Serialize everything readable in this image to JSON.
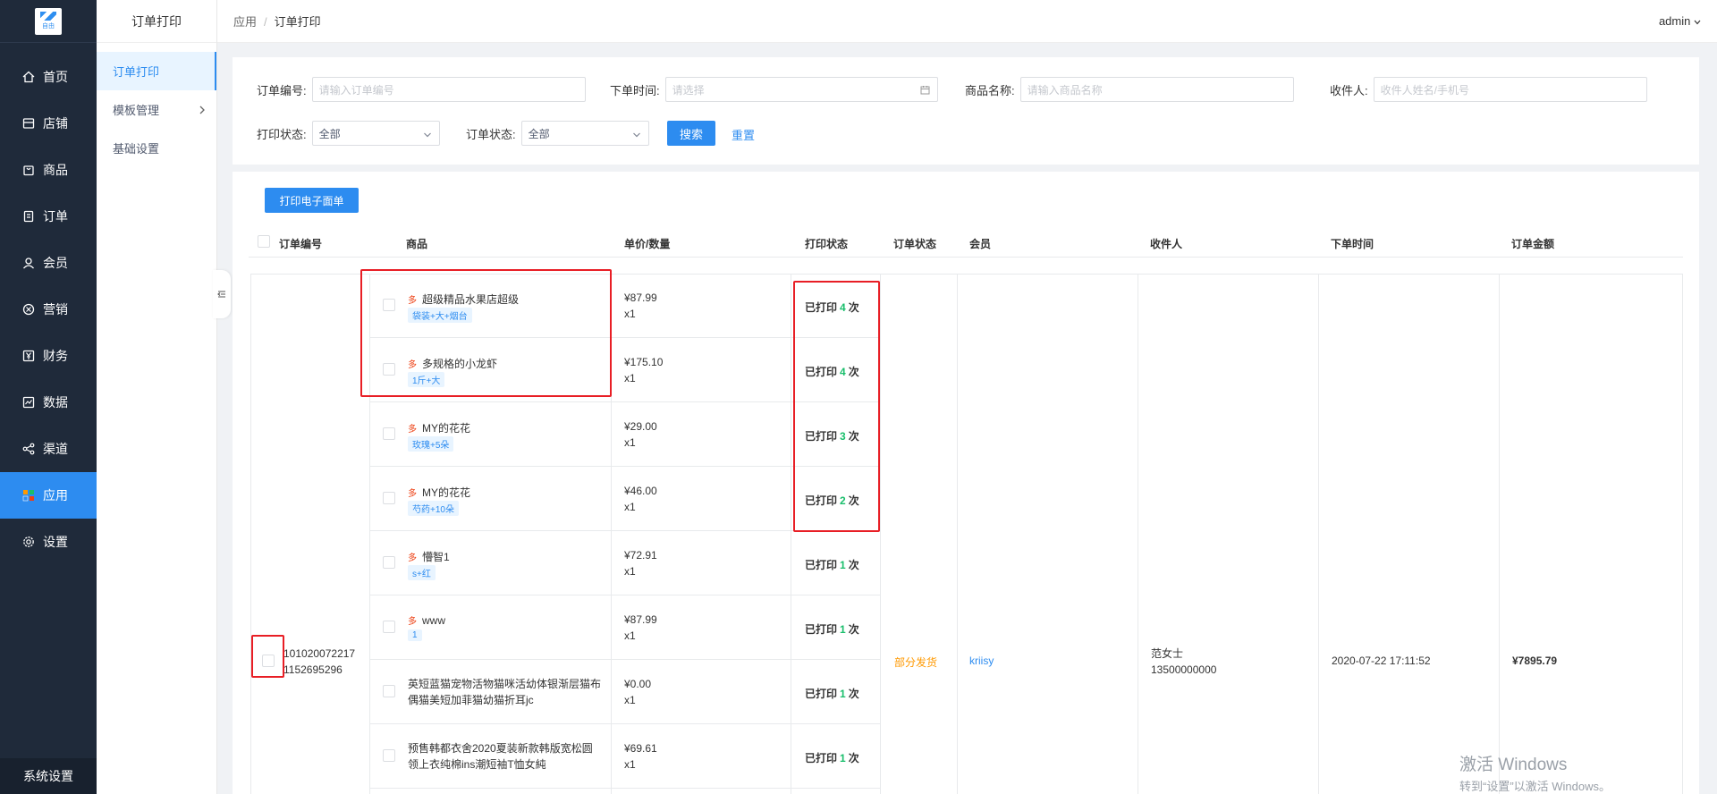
{
  "nav": {
    "logo_text": "自由",
    "items": [
      {
        "label": "首页",
        "icon": "home-icon"
      },
      {
        "label": "店铺",
        "icon": "store-icon"
      },
      {
        "label": "商品",
        "icon": "bag-icon"
      },
      {
        "label": "订单",
        "icon": "order-icon"
      },
      {
        "label": "会员",
        "icon": "user-icon"
      },
      {
        "label": "营销",
        "icon": "marketing-icon"
      },
      {
        "label": "财务",
        "icon": "yen-icon"
      },
      {
        "label": "数据",
        "icon": "chart-icon"
      },
      {
        "label": "渠道",
        "icon": "channel-icon"
      },
      {
        "label": "应用",
        "icon": "apps-icon"
      },
      {
        "label": "设置",
        "icon": "gear-icon"
      }
    ],
    "system": "系统设置"
  },
  "subnav": {
    "title": "订单打印",
    "items": [
      "订单打印",
      "模板管理",
      "基础设置"
    ]
  },
  "breadcrumb": {
    "root": "应用",
    "current": "订单打印"
  },
  "user": "admin",
  "filters": {
    "order_no": {
      "label": "订单编号:",
      "placeholder": "请输入订单编号"
    },
    "order_time": {
      "label": "下单时间:",
      "placeholder": "请选择"
    },
    "goods_name": {
      "label": "商品名称:",
      "placeholder": "请输入商品名称"
    },
    "receiver": {
      "label": "收件人:",
      "placeholder": "收件人姓名/手机号"
    },
    "print_status": {
      "label": "打印状态:",
      "value": "全部"
    },
    "order_status": {
      "label": "订单状态:",
      "value": "全部"
    },
    "search": "搜索",
    "reset": "重置"
  },
  "print_button": "打印电子面单",
  "columns": [
    "订单编号",
    "商品",
    "单价/数量",
    "打印状态",
    "订单状态",
    "会员",
    "收件人",
    "下单时间",
    "订单金额"
  ],
  "order": {
    "order_no_1": "101020072217",
    "order_no_2": "1152695296",
    "status": "部分发货",
    "member": "kriisy",
    "receiver_name": "范女士",
    "receiver_phone": "13500000000",
    "time": "2020-07-22 17:11:52",
    "amount": "¥7895.79"
  },
  "printed_prefix": "已打印",
  "printed_suffix": "次",
  "multi_tag": "多",
  "goods": [
    {
      "name": "超级精品水果店超级",
      "spec": "袋装+大+烟台",
      "price": "¥87.99",
      "qty": "x1",
      "printed": "4",
      "multi": true
    },
    {
      "name": "多规格的小龙虾",
      "spec": "1斤+大",
      "price": "¥175.10",
      "qty": "x1",
      "printed": "4",
      "multi": true
    },
    {
      "name": "MY的花花",
      "spec": "玫瑰+5朵",
      "price": "¥29.00",
      "qty": "x1",
      "printed": "3",
      "multi": true
    },
    {
      "name": "MY的花花",
      "spec": "芍药+10朵",
      "price": "¥46.00",
      "qty": "x1",
      "printed": "2",
      "multi": true
    },
    {
      "name": "懵智1",
      "spec": "s+红",
      "price": "¥72.91",
      "qty": "x1",
      "printed": "1",
      "multi": true
    },
    {
      "name": "www",
      "spec": "1",
      "price": "¥87.99",
      "qty": "x1",
      "printed": "1",
      "multi": true
    },
    {
      "name": "英短蓝猫宠物活物猫咪活幼体银渐层猫布",
      "name2": "偶猫美短加菲猫幼猫折耳jc",
      "price": "¥0.00",
      "qty": "x1",
      "printed": "1",
      "multi": false
    },
    {
      "name": "预售韩都衣舍2020夏装新款韩版宽松圆",
      "name2": "领上衣纯棉ins潮短袖T恤女純",
      "price": "¥69.61",
      "qty": "x1",
      "printed": "1",
      "multi": false
    }
  ],
  "watermark": {
    "line1": "激活 Windows",
    "line2": "转到“设置”以激活 Windows。"
  },
  "colors": {
    "primary": "#2d8cf0",
    "sidebar": "#1f2a3a",
    "highlight": "#e81e25",
    "warning": "#ff9900",
    "success": "#19be6b"
  }
}
